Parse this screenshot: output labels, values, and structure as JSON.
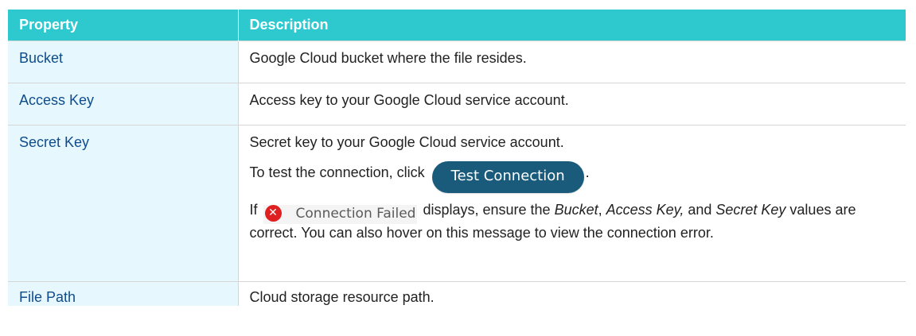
{
  "table": {
    "headers": {
      "property": "Property",
      "description": "Description"
    },
    "rows": [
      {
        "property": "Bucket",
        "description": "Google Cloud bucket where the file resides."
      },
      {
        "property": "Access Key",
        "description": "Access key to your Google Cloud service account."
      },
      {
        "property": "Secret Key",
        "description": "Secret key to your Google Cloud service account.",
        "test_prefix": "To test the connection, click",
        "test_button": "Test Connection",
        "test_suffix": ".",
        "fail_prefix": "If",
        "fail_badge_text": "Connection Failed",
        "fail_mid": " displays, ensure the ",
        "fail_bucket": "Bucket",
        "fail_sep1": ", ",
        "fail_access": "Access Key,",
        "fail_and": " and ",
        "fail_secret": "Secret Key",
        "fail_rest": " values are correct. You can also hover on this message to view the connection error."
      },
      {
        "property": "File Path",
        "description": "Cloud storage resource path."
      }
    ]
  },
  "icons": {
    "fail_icon": "close-circle-icon",
    "fail_icon_color": "#e02020"
  },
  "colors": {
    "header_bg": "#2ec9cf",
    "property_bg": "#e6f7fd",
    "property_text": "#0f4c8c",
    "button_bg": "#1a5b7c"
  }
}
